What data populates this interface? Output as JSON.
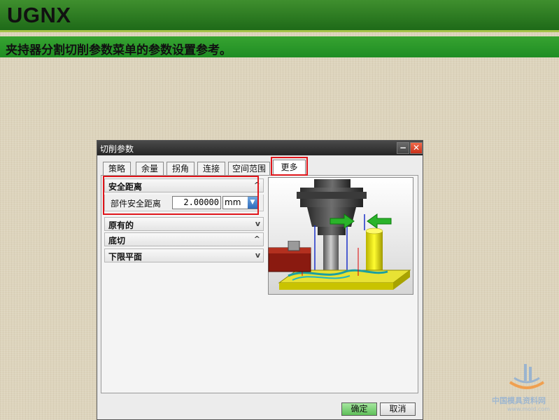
{
  "slide": {
    "title": "UGNX",
    "subtitle": "夹持器分割切削参数菜单的参数设置参考。"
  },
  "dialog": {
    "title": "切削参数",
    "window_buttons": {
      "minimize": "−",
      "close": "✕"
    },
    "tabs": [
      {
        "label": "策略",
        "active": false
      },
      {
        "label": "余量",
        "active": false
      },
      {
        "label": "拐角",
        "active": false
      },
      {
        "label": "连接",
        "active": false
      },
      {
        "label": "空间范围",
        "active": false
      },
      {
        "label": "更多",
        "active": true
      }
    ],
    "groups": {
      "safe_distance": {
        "label": "安全距离",
        "expanded": true,
        "chevron": "^"
      },
      "original": {
        "label": "原有的",
        "expanded": false,
        "chevron": "v"
      },
      "undercut": {
        "label": "底切",
        "expanded": true,
        "chevron": "^"
      },
      "lower_limit_plane": {
        "label": "下限平面",
        "expanded": false,
        "chevron": "v"
      }
    },
    "part_safe_distance": {
      "label": "部件安全距离",
      "value": "2.00000",
      "unit": "mm",
      "unit_dropdown_icon": "▼"
    },
    "buttons": {
      "ok": "确定",
      "cancel": "取消"
    }
  },
  "colors": {
    "title_green": "#2a7a22",
    "subtitle_green": "#2a9a2a",
    "highlight_red": "#e0161b",
    "ok_green": "#7fd27a"
  },
  "watermark": {
    "text": "中国模具资料网",
    "sub": "www.mold.com"
  }
}
